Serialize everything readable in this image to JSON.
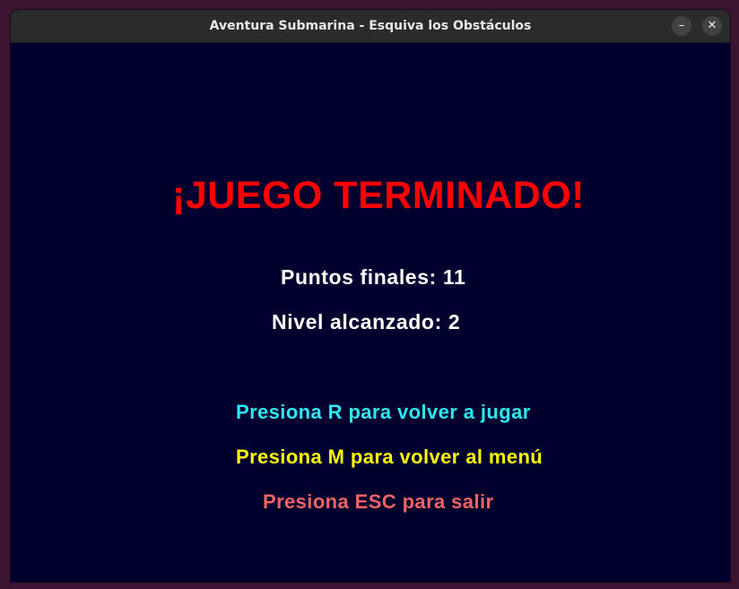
{
  "window": {
    "title": "Aventura Submarina - Esquiva los Obstáculos",
    "minimize_glyph": "–",
    "close_glyph": "✕"
  },
  "game_over": {
    "heading": "¡JUEGO TERMINADO!",
    "final_score": "Puntos finales: 11",
    "level_reached": "Nivel alcanzado: 2",
    "options": {
      "restart": "Presiona R para volver a jugar",
      "menu": "Presiona M para volver al menú",
      "quit": "Presiona ESC para salir"
    }
  },
  "colors": {
    "background": "#00002e",
    "heading": "#ff0000",
    "stats": "#ffffff",
    "restart": "#2ee8ef",
    "menu": "#ffff00",
    "quit": "#f06464"
  }
}
